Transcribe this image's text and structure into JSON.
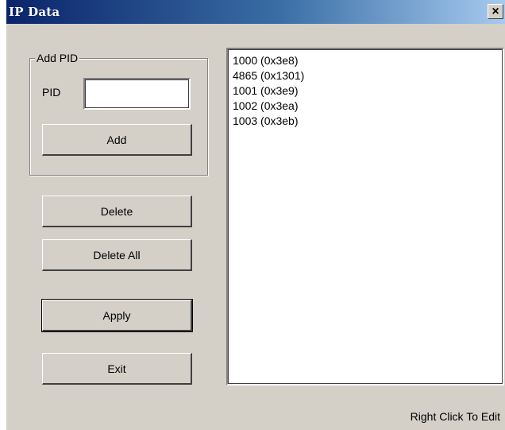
{
  "window": {
    "title": "IP Data",
    "close_glyph": "×"
  },
  "add_group": {
    "label": "Add PID",
    "pid_label": "PID",
    "pid_value": "",
    "add_button": "Add"
  },
  "buttons": {
    "delete": "Delete",
    "delete_all": "Delete All",
    "apply": "Apply",
    "exit": "Exit"
  },
  "pid_list": [
    "1000 (0x3e8)",
    "4865 (0x1301)",
    "1001 (0x3e9)",
    "1002 (0x3ea)",
    "1003 (0x3eb)"
  ],
  "hint": "Right Click To Edit",
  "colors": {
    "face": "#d4d0c8",
    "title_start": "#0a246a",
    "title_end": "#a6caf0"
  },
  "icons": {
    "close": "close-icon"
  }
}
